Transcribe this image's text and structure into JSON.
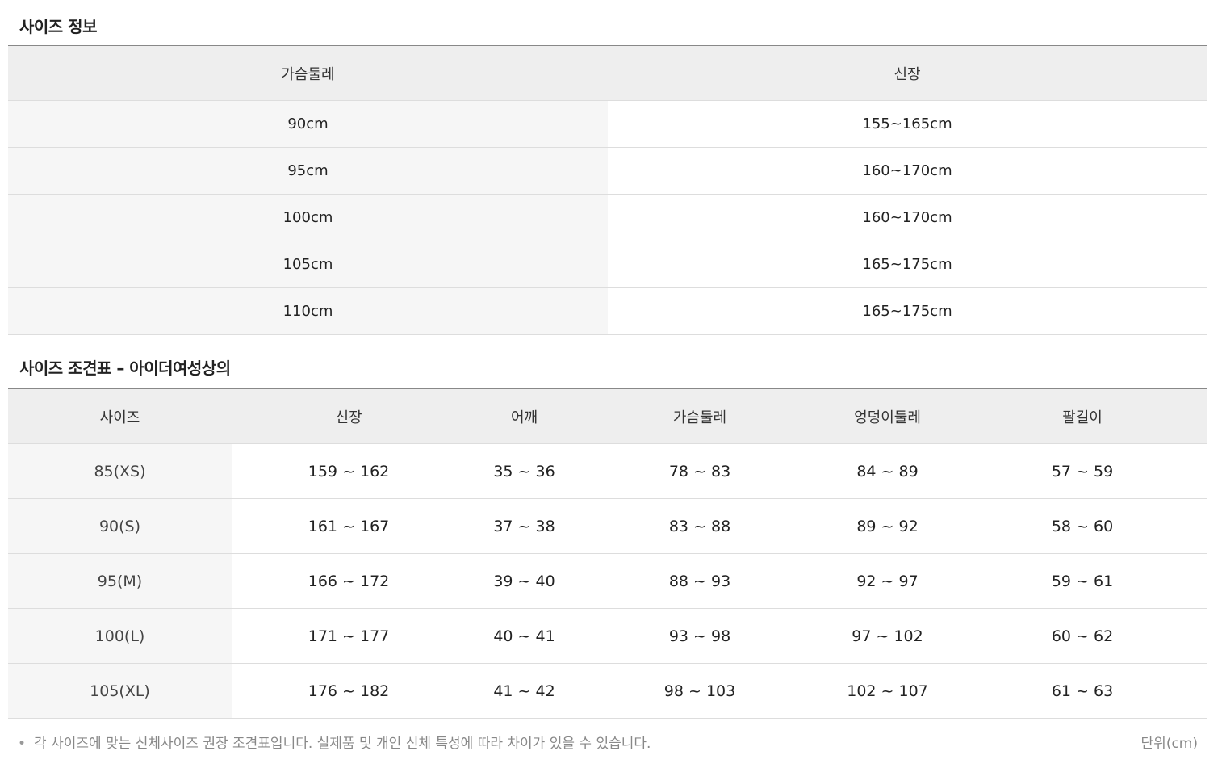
{
  "size_info": {
    "title": "사이즈 정보",
    "headers": [
      "가슴둘레",
      "신장"
    ],
    "rows": [
      [
        "90cm",
        "155~165cm"
      ],
      [
        "95cm",
        "160~170cm"
      ],
      [
        "100cm",
        "160~170cm"
      ],
      [
        "105cm",
        "165~175cm"
      ],
      [
        "110cm",
        "165~175cm"
      ]
    ]
  },
  "size_chart": {
    "title": "사이즈 조견표 – 아이더여성상의",
    "headers": [
      "사이즈",
      "신장",
      "어깨",
      "가슴둘레",
      "엉덩이둘레",
      "팔길이"
    ],
    "rows": [
      [
        "85(XS)",
        "159 ~ 162",
        "35 ~ 36",
        "78 ~ 83",
        "84 ~ 89",
        "57 ~ 59"
      ],
      [
        "90(S)",
        "161 ~ 167",
        "37 ~ 38",
        "83 ~ 88",
        "89 ~ 92",
        "58 ~ 60"
      ],
      [
        "95(M)",
        "166 ~ 172",
        "39 ~ 40",
        "88 ~ 93",
        "92 ~ 97",
        "59 ~ 61"
      ],
      [
        "100(L)",
        "171 ~ 177",
        "40 ~ 41",
        "93 ~ 98",
        "97 ~ 102",
        "60 ~ 62"
      ],
      [
        "105(XL)",
        "176 ~ 182",
        "41 ~ 42",
        "98 ~ 103",
        "102 ~ 107",
        "61 ~ 63"
      ]
    ]
  },
  "footer": {
    "bullet": "•",
    "note": "각 사이즈에 맞는 신체사이즈 권장 조견표입니다. 실제품 및 개인 신체 특성에 따라 차이가 있을 수 있습니다.",
    "unit": "단위(cm)"
  }
}
